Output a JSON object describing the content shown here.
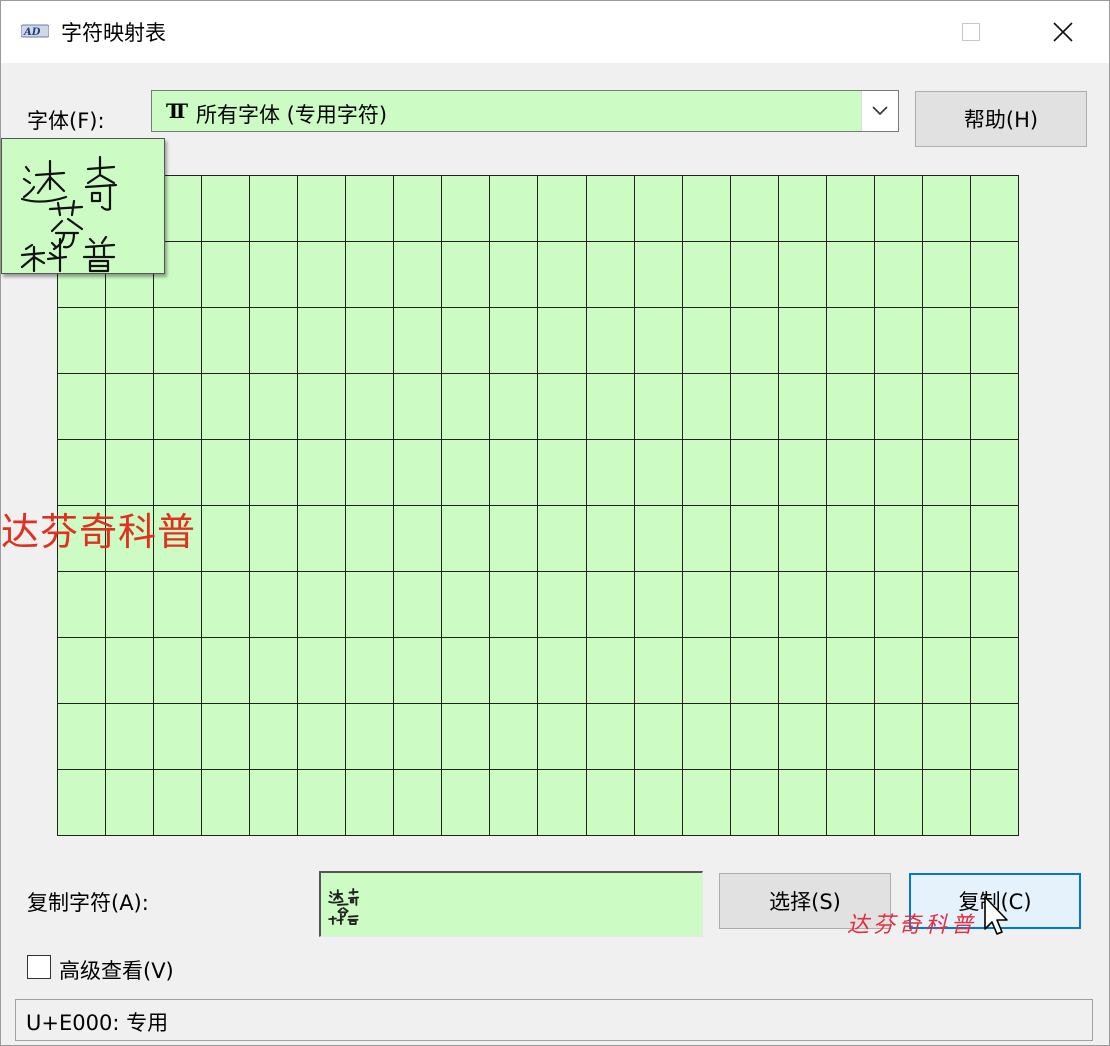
{
  "window": {
    "title": "字符映射表",
    "app_icon": "charmap-icon",
    "minimize_icon": "minimize-icon",
    "maximize_icon": "maximize-icon",
    "close_icon": "close-icon"
  },
  "font_row": {
    "label": "字体(F):",
    "selected_font": "所有字体 (专用字符)",
    "font_type_icon": "truetype-icon",
    "dropdown_icon": "chevron-down-icon",
    "help_button": "帮助(H)"
  },
  "character_grid": {
    "columns": 20,
    "rows": 10,
    "cell_color": "#ccfcc4",
    "enlarged_character": "达奇芬科普"
  },
  "watermarks": {
    "left": "达芬奇科普",
    "bottom_right": "达芬奇科普"
  },
  "copy_row": {
    "label": "复制字符(A):",
    "value": "达奇芬科普",
    "select_button": "选择(S)",
    "copy_button": "复制(C)"
  },
  "advanced": {
    "label": "高级查看(V)",
    "checked": false
  },
  "status": {
    "text": "U+E000: 专用"
  },
  "colors": {
    "grid_fill": "#ccfcc4",
    "watermark": "#e03020",
    "focus_border": "#0078d7"
  }
}
